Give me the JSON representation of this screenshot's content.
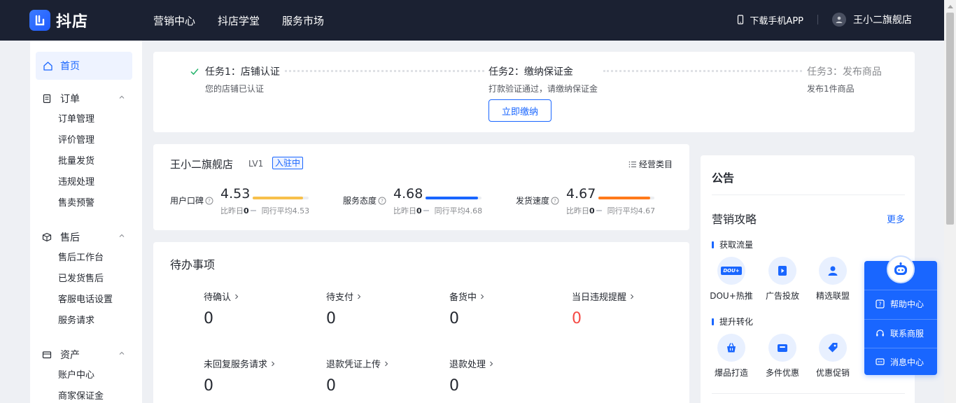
{
  "topbar": {
    "logo_text": "抖店",
    "nav": [
      "营销中心",
      "抖店学堂",
      "服务市场"
    ],
    "download_app": "下载手机APP",
    "user_name": "王小二旗舰店"
  },
  "sidebar": {
    "home": "首页",
    "groups": [
      {
        "title": "订单",
        "icon": "order-icon",
        "items": [
          "订单管理",
          "评价管理",
          "批量发货",
          "违规处理",
          "售卖预警"
        ]
      },
      {
        "title": "售后",
        "icon": "box-icon",
        "items": [
          "售后工作台",
          "已发货售后",
          "客服电话设置",
          "服务请求"
        ]
      },
      {
        "title": "资产",
        "icon": "wallet-icon",
        "items": [
          "账户中心",
          "商家保证金"
        ]
      }
    ]
  },
  "tasks": [
    {
      "title": "任务1：店铺认证",
      "sub": "您的店铺已认证",
      "status": "done"
    },
    {
      "title": "任务2：缴纳保证金",
      "sub": "打款验证通过，请缴纳保证金",
      "status": "active",
      "button": "立即缴纳"
    },
    {
      "title": "任务3：发布商品",
      "sub": "发布1件商品",
      "status": "pending"
    }
  ],
  "shop": {
    "name": "王小二旗舰店",
    "level": "LV1",
    "badge": "入驻中",
    "category_link": "经营类目",
    "metrics": [
      {
        "label": "用户口碑",
        "value": "4.53",
        "compare_prefix": "比昨日",
        "compare_value": "0",
        "industry": "同行平均4.53",
        "color": "#f7c04b",
        "fill": 0.9
      },
      {
        "label": "服务态度",
        "value": "4.68",
        "compare_prefix": "比昨日",
        "compare_value": "0",
        "industry": "同行平均4.68",
        "color": "#1966ff",
        "fill": 0.94
      },
      {
        "label": "发货速度",
        "value": "4.67",
        "compare_prefix": "比昨日",
        "compare_value": "0",
        "industry": "同行平均4.67",
        "color": "#ff7a1a",
        "fill": 0.93
      }
    ]
  },
  "todo": {
    "title": "待办事项",
    "items": [
      {
        "label": "待确认",
        "count": "0"
      },
      {
        "label": "待支付",
        "count": "0"
      },
      {
        "label": "备货中",
        "count": "0"
      },
      {
        "label": "当日违规提醒",
        "count": "0",
        "alert": true
      },
      {
        "label": "未回复服务请求",
        "count": "0"
      },
      {
        "label": "退款凭证上传",
        "count": "0"
      },
      {
        "label": "退款处理",
        "count": "0"
      }
    ]
  },
  "notice": {
    "title": "公告",
    "market_title": "营销攻略",
    "more": "更多",
    "sections": [
      {
        "title": "获取流量",
        "tools": [
          {
            "label": "DOU+热推",
            "icon": "dou-plus-icon",
            "icon_text": "DOU+"
          },
          {
            "label": "广告投放",
            "icon": "ad-icon"
          },
          {
            "label": "精选联盟",
            "icon": "alliance-icon"
          }
        ]
      },
      {
        "title": "提升转化",
        "tools": [
          {
            "label": "爆品打造",
            "icon": "basket-icon"
          },
          {
            "label": "多件优惠",
            "icon": "wallet-icon"
          },
          {
            "label": "优惠促销",
            "icon": "tag-icon"
          }
        ]
      }
    ]
  },
  "help": {
    "items": [
      "帮助中心",
      "联系商服",
      "消息中心"
    ]
  },
  "colors": {
    "accent": "#1966ff",
    "topbar": "#1b2132",
    "alert": "#f54a45"
  }
}
